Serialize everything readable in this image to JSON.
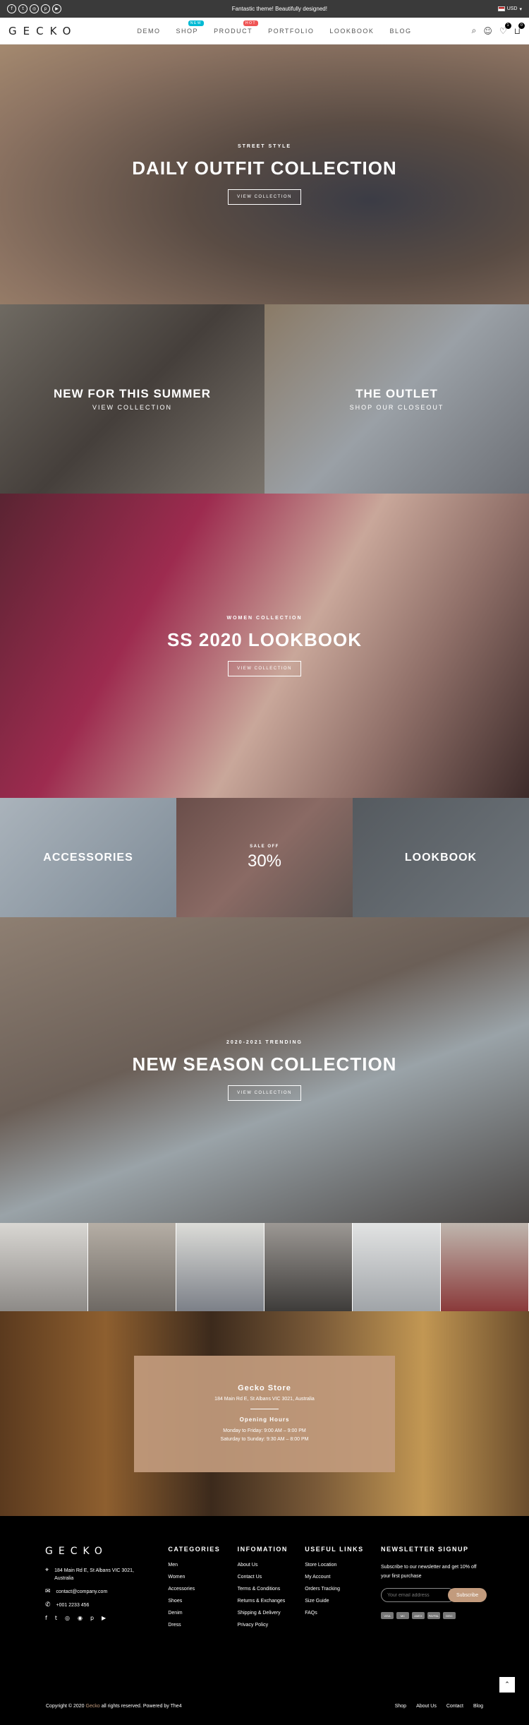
{
  "topbar": {
    "socials": [
      {
        "icon": "facebook-icon",
        "glyph": "f"
      },
      {
        "icon": "twitter-icon",
        "glyph": "t"
      },
      {
        "icon": "instagram-icon",
        "glyph": "◎"
      },
      {
        "icon": "pinterest-icon",
        "glyph": "p"
      },
      {
        "icon": "youtube-icon",
        "glyph": "▶"
      }
    ],
    "promo": "Fantastic theme! Beautifully designed!",
    "currency": "USD"
  },
  "header": {
    "logo": "GECKO",
    "menu": [
      {
        "label": "DEMO"
      },
      {
        "label": "SHOP",
        "badge": "NEW",
        "badge_color": "#01bad4"
      },
      {
        "label": "PRODUCT",
        "badge": "HOT",
        "badge_color": "#ef5555"
      },
      {
        "label": "PORTFOLIO"
      },
      {
        "label": "LOOKBOOK"
      },
      {
        "label": "BLOG"
      }
    ],
    "wishlist_count": "1",
    "cart_count": "0"
  },
  "hero1": {
    "eyebrow": "STREET STYLE",
    "title": "DAILY OUTFIT COLLECTION",
    "button": "VIEW COLLECTION"
  },
  "promo_tiles": [
    {
      "title": "NEW FOR THIS SUMMER",
      "sub": "VIEW COLLECTION"
    },
    {
      "title": "THE OUTLET",
      "sub": "SHOP OUR CLOSEOUT"
    }
  ],
  "hero2": {
    "eyebrow": "WOMEN COLLECTION",
    "title": "SS 2020 LOOKBOOK",
    "button": "VIEW COLLECTION"
  },
  "category_tiles": {
    "accessories": "ACCESSORIES",
    "sale_label": "SALE OFF",
    "sale_value": "30%",
    "lookbook": "LOOKBOOK"
  },
  "hero3": {
    "eyebrow": "2020-2021 TRENDING",
    "title": "NEW SEASON COLLECTION",
    "button": "VIEW COLLECTION"
  },
  "store": {
    "name": "Gecko Store",
    "address": "184 Main Rd E, St Albans VIC 3021, Australia",
    "hours_title": "Opening Hours",
    "hours_weekday": "Monday to Friday: 9:00 AM – 9:00 PM",
    "hours_weekend": "Saturday to Sunday: 9:30 AM – 8:00 PM"
  },
  "footer": {
    "logo": "GECKO",
    "address": "184 Main Rd E, St Albans VIC 3021, Australia",
    "email": "contact@company.com",
    "phone": "+001 2233 456",
    "socials": [
      "f",
      "t",
      "◎",
      "◉",
      "p",
      "▶"
    ],
    "categories_title": "CATEGORIES",
    "categories": [
      "Men",
      "Women",
      "Accessories",
      "Shoes",
      "Denim",
      "Dress"
    ],
    "info_title": "INFOMATION",
    "info": [
      "About Us",
      "Contact Us",
      "Terms & Conditions",
      "Returns & Exchanges",
      "Shipping & Delivery",
      "Privacy Policy"
    ],
    "links_title": "USEFUL LINKS",
    "links": [
      "Store Location",
      "My Account",
      "Orders Tracking",
      "Size Guide",
      "FAQs"
    ],
    "newsletter_title": "NEWSLETTER SIGNUP",
    "newsletter_text": "Subscribe to our newsletter and get 10% off your first purchase",
    "newsletter_placeholder": "Your email address",
    "newsletter_button": "Subscribe",
    "payments": [
      "VISA",
      "MC",
      "AMEX",
      "PAYPAL",
      "DISC"
    ],
    "copyright_pre": "Copyright © 2020 ",
    "copyright_brand": "Gecko",
    "copyright_post": " all rights reserved. Powered by The4",
    "bottom_links": [
      "Shop",
      "About Us",
      "Contact",
      "Blog"
    ]
  }
}
